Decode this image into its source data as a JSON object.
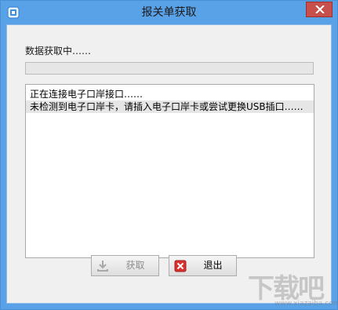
{
  "window": {
    "title": "报关单获取"
  },
  "status": {
    "label": "数据获取中……",
    "progress_percent": 0
  },
  "log": {
    "lines": [
      "正在连接电子口岸接口……",
      "未检测到电子口岸卡，请插入电子口岸卡或尝试更换USB插口……"
    ]
  },
  "buttons": {
    "fetch_label": "获取",
    "exit_label": "退出"
  },
  "watermark": {
    "text": "下载吧",
    "sub": "www.xiazaiba.com"
  },
  "colors": {
    "titlebar": "#5aa2e8",
    "close_button": "#c7504c",
    "client_bg": "#f0f0f0"
  }
}
